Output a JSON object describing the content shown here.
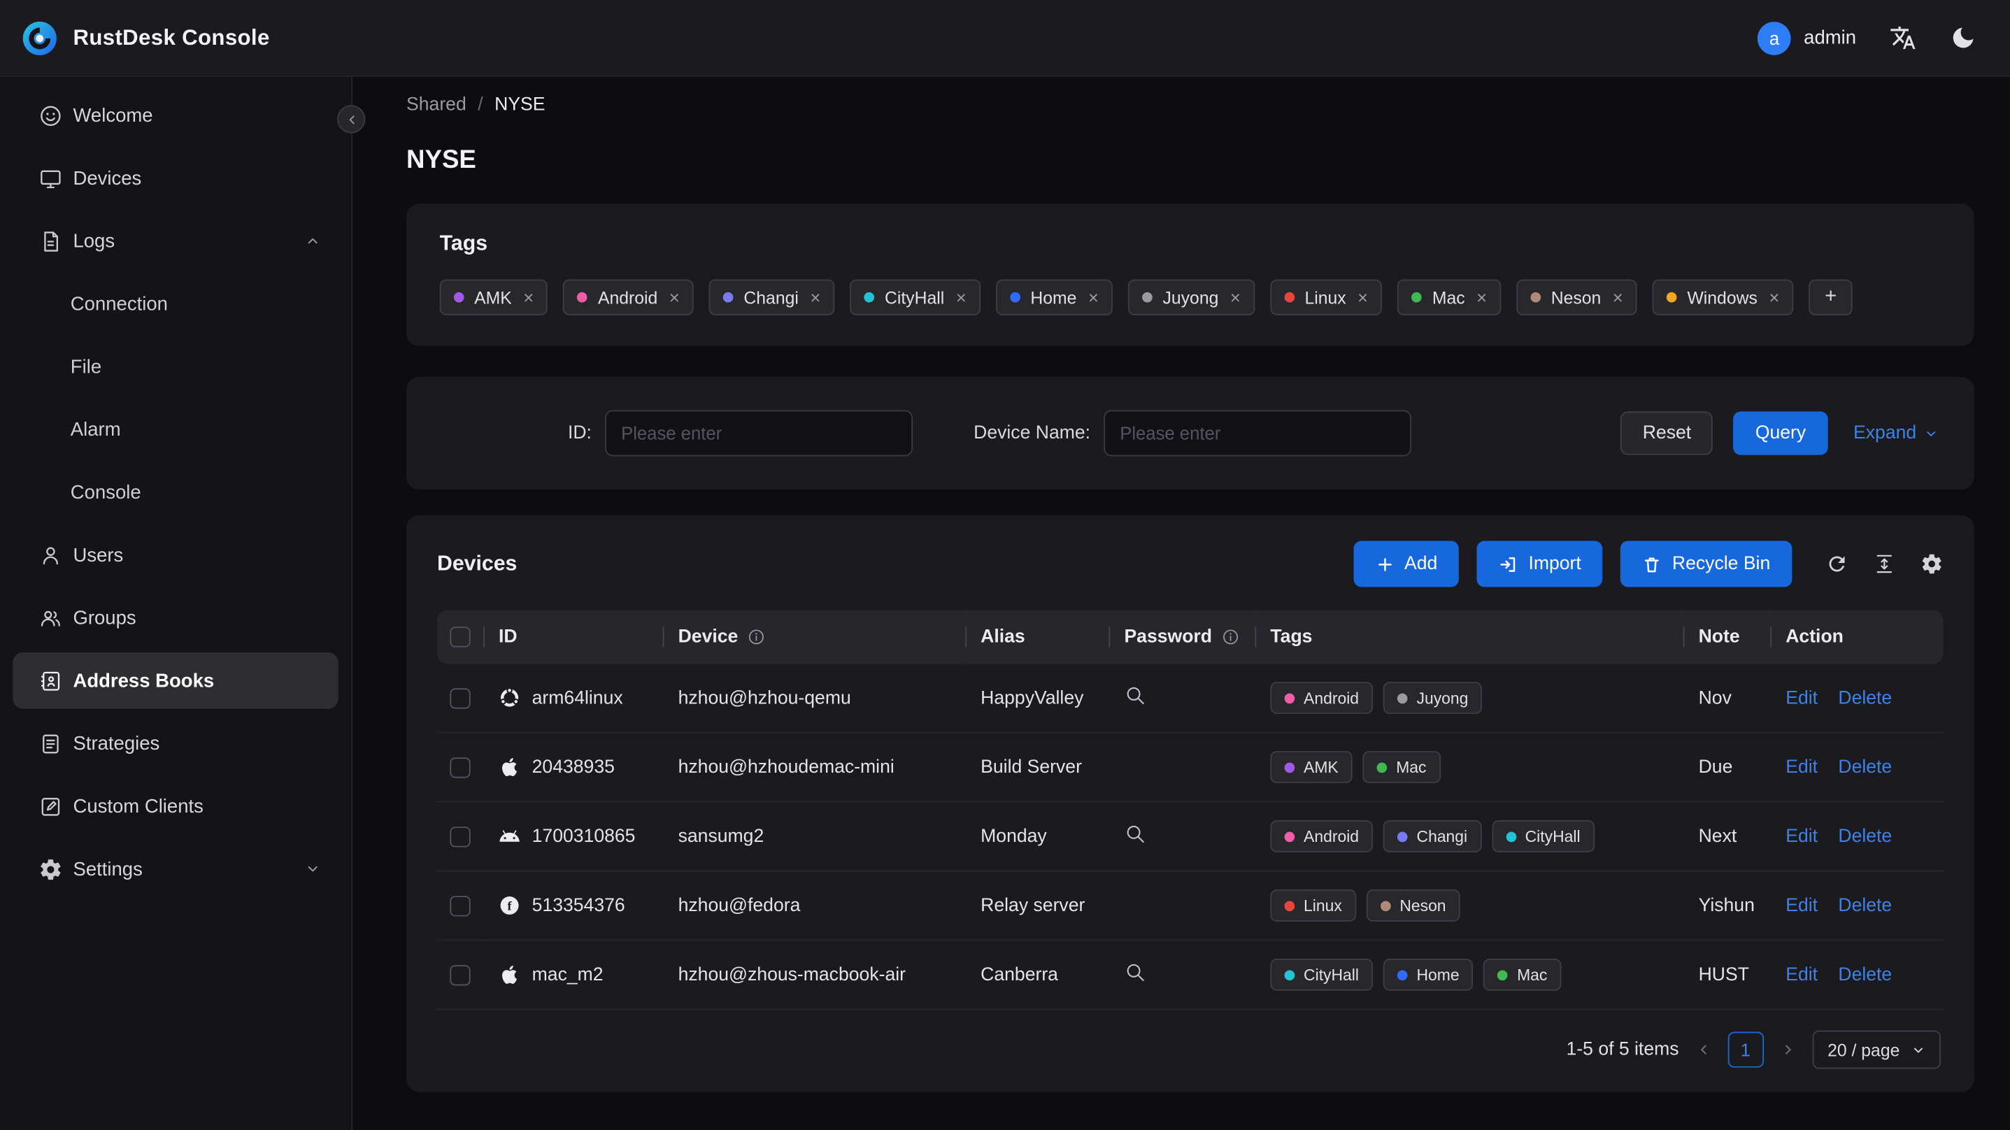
{
  "colors": {
    "accent": "#1668dc",
    "link": "#3c82e8",
    "avatar_bg": "#2e7cf6"
  },
  "icons": {
    "close_glyph": "×",
    "add_glyph": "+"
  },
  "header": {
    "app_title": "RustDesk Console",
    "user": {
      "avatar_letter": "a",
      "name": "admin"
    }
  },
  "sidebar": {
    "items": [
      {
        "label": "Welcome"
      },
      {
        "label": "Devices"
      },
      {
        "label": "Logs",
        "expanded": true
      },
      {
        "label": "Connection",
        "child": true
      },
      {
        "label": "File",
        "child": true
      },
      {
        "label": "Alarm",
        "child": true
      },
      {
        "label": "Console",
        "child": true
      },
      {
        "label": "Users"
      },
      {
        "label": "Groups"
      },
      {
        "label": "Address Books",
        "active": true
      },
      {
        "label": "Strategies"
      },
      {
        "label": "Custom Clients"
      },
      {
        "label": "Settings",
        "collapsed": true
      }
    ]
  },
  "breadcrumb": {
    "parent": "Shared",
    "separator": "/",
    "current": "NYSE"
  },
  "page_title": "NYSE",
  "tags_card": {
    "title": "Tags",
    "tags": [
      {
        "label": "AMK",
        "color": "#a259e6"
      },
      {
        "label": "Android",
        "color": "#ef5da8"
      },
      {
        "label": "Changi",
        "color": "#7a7af0"
      },
      {
        "label": "CityHall",
        "color": "#22c3d6"
      },
      {
        "label": "Home",
        "color": "#2f6bff"
      },
      {
        "label": "Juyong",
        "color": "#9a9aa0"
      },
      {
        "label": "Linux",
        "color": "#e8453c"
      },
      {
        "label": "Mac",
        "color": "#3fb950"
      },
      {
        "label": "Neson",
        "color": "#b08a78"
      },
      {
        "label": "Windows",
        "color": "#f5a524"
      }
    ]
  },
  "filter": {
    "id_label": "ID:",
    "id_placeholder": "Please enter",
    "device_name_label": "Device Name:",
    "device_name_placeholder": "Please enter",
    "reset_label": "Reset",
    "query_label": "Query",
    "expand_label": "Expand"
  },
  "devices_card": {
    "title": "Devices",
    "toolbar": {
      "add": "Add",
      "import": "Import",
      "recycle_bin": "Recycle Bin"
    },
    "columns": [
      "ID",
      "Device",
      "Alias",
      "Password",
      "Tags",
      "Note",
      "Action"
    ],
    "actions": {
      "edit": "Edit",
      "delete": "Delete"
    },
    "rows": [
      {
        "id": "arm64linux",
        "os_icon": "ubuntu-icon",
        "device": "hzhou@hzhou-qemu",
        "alias": "HappyValley",
        "has_password": true,
        "tags": [
          "Android",
          "Juyong"
        ],
        "note": "Nov"
      },
      {
        "id": "20438935",
        "os_icon": "apple-icon",
        "device": "hzhou@hzhoudemac-mini",
        "alias": "Build Server",
        "has_password": false,
        "tags": [
          "AMK",
          "Mac"
        ],
        "note": "Due"
      },
      {
        "id": "1700310865",
        "os_icon": "android-icon",
        "device": "sansumg2",
        "alias": "Monday",
        "has_password": true,
        "tags": [
          "Android",
          "Changi",
          "CityHall"
        ],
        "note": "Next"
      },
      {
        "id": "513354376",
        "os_icon": "linux-icon",
        "device": "hzhou@fedora",
        "alias": "Relay server",
        "has_password": false,
        "tags": [
          "Linux",
          "Neson"
        ],
        "note": "Yishun"
      },
      {
        "id": "mac_m2",
        "os_icon": "apple-icon",
        "device": "hzhou@zhous-macbook-air",
        "alias": "Canberra",
        "has_password": true,
        "tags": [
          "CityHall",
          "Home",
          "Mac"
        ],
        "note": "HUST"
      }
    ],
    "pagination": {
      "summary": "1-5 of 5 items",
      "page": "1",
      "page_size": "20 / page"
    }
  }
}
